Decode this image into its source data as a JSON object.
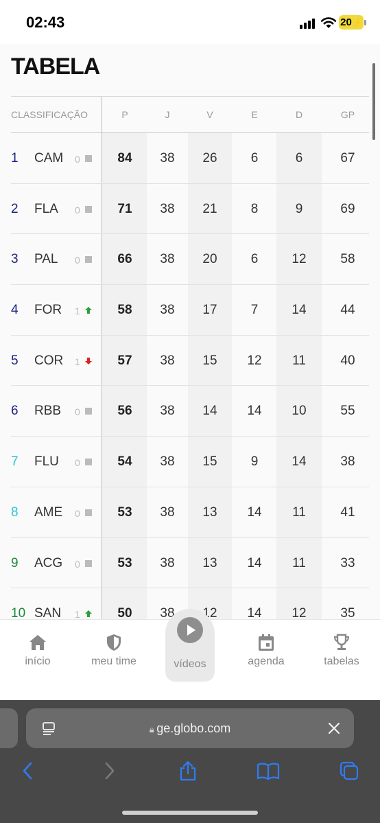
{
  "status_bar": {
    "time": "02:43",
    "battery": "20"
  },
  "page": {
    "title": "TABELA",
    "columns_label": "CLASSIFICAÇÃO",
    "columns": [
      "P",
      "J",
      "V",
      "E",
      "D",
      "GP"
    ],
    "rows": [
      {
        "pos": "1",
        "team": "CAM",
        "var": "0",
        "trend": "same",
        "pos_color": "#1a237e",
        "stats": [
          "84",
          "38",
          "26",
          "6",
          "6",
          "67"
        ]
      },
      {
        "pos": "2",
        "team": "FLA",
        "var": "0",
        "trend": "same",
        "pos_color": "#1a237e",
        "stats": [
          "71",
          "38",
          "21",
          "8",
          "9",
          "69"
        ]
      },
      {
        "pos": "3",
        "team": "PAL",
        "var": "0",
        "trend": "same",
        "pos_color": "#1a237e",
        "stats": [
          "66",
          "38",
          "20",
          "6",
          "12",
          "58"
        ]
      },
      {
        "pos": "4",
        "team": "FOR",
        "var": "1",
        "trend": "up",
        "pos_color": "#1a237e",
        "stats": [
          "58",
          "38",
          "17",
          "7",
          "14",
          "44"
        ]
      },
      {
        "pos": "5",
        "team": "COR",
        "var": "1",
        "trend": "down",
        "pos_color": "#1a237e",
        "stats": [
          "57",
          "38",
          "15",
          "12",
          "11",
          "40"
        ]
      },
      {
        "pos": "6",
        "team": "RBB",
        "var": "0",
        "trend": "same",
        "pos_color": "#1a237e",
        "stats": [
          "56",
          "38",
          "14",
          "14",
          "10",
          "55"
        ]
      },
      {
        "pos": "7",
        "team": "FLU",
        "var": "0",
        "trend": "same",
        "pos_color": "#2ec4d6",
        "stats": [
          "54",
          "38",
          "15",
          "9",
          "14",
          "38"
        ]
      },
      {
        "pos": "8",
        "team": "AME",
        "var": "0",
        "trend": "same",
        "pos_color": "#2ec4d6",
        "stats": [
          "53",
          "38",
          "13",
          "14",
          "11",
          "41"
        ]
      },
      {
        "pos": "9",
        "team": "ACG",
        "var": "0",
        "trend": "same",
        "pos_color": "#1b8a3a",
        "stats": [
          "53",
          "38",
          "13",
          "14",
          "11",
          "33"
        ]
      },
      {
        "pos": "10",
        "team": "SAN",
        "var": "1",
        "trend": "up",
        "pos_color": "#1b8a3a",
        "stats": [
          "50",
          "38",
          "12",
          "14",
          "12",
          "35"
        ]
      }
    ]
  },
  "nav": {
    "items": [
      {
        "label": "início",
        "icon": "home-icon"
      },
      {
        "label": "meu time",
        "icon": "shield-icon"
      },
      {
        "label": "vídeos",
        "icon": "play-icon"
      },
      {
        "label": "agenda",
        "icon": "calendar-icon"
      },
      {
        "label": "tabelas",
        "icon": "trophy-icon"
      }
    ]
  },
  "browser": {
    "url": "ge.globo.com"
  },
  "colors": {
    "up": "#2e9e3a",
    "down": "#e02020",
    "same": "#bbbbbb",
    "ios_blue": "#2f7cf6"
  }
}
